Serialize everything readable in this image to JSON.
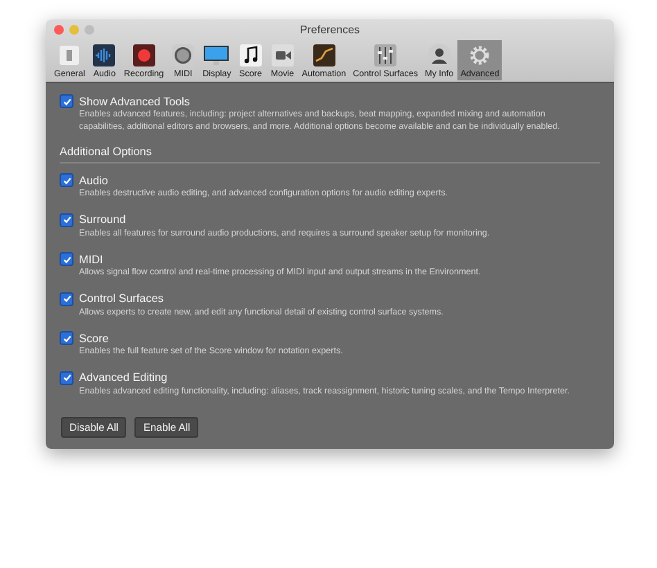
{
  "window": {
    "title": "Preferences"
  },
  "toolbar": [
    {
      "label": "General",
      "selected": false
    },
    {
      "label": "Audio",
      "selected": false
    },
    {
      "label": "Recording",
      "selected": false
    },
    {
      "label": "MIDI",
      "selected": false
    },
    {
      "label": "Display",
      "selected": false
    },
    {
      "label": "Score",
      "selected": false
    },
    {
      "label": "Movie",
      "selected": false
    },
    {
      "label": "Automation",
      "selected": false
    },
    {
      "label": "Control Surfaces",
      "selected": false
    },
    {
      "label": "My Info",
      "selected": false
    },
    {
      "label": "Advanced",
      "selected": true
    }
  ],
  "main_option": {
    "label": "Show Advanced Tools",
    "checked": true,
    "description": "Enables advanced features, including: project alternatives and backups, beat mapping, expanded mixing and automation capabilities, additional editors and browsers, and more. Additional options become available and can be individually enabled."
  },
  "section": {
    "title": "Additional Options",
    "options": [
      {
        "label": "Audio",
        "checked": true,
        "description": "Enables destructive audio editing, and advanced configuration options for audio editing experts."
      },
      {
        "label": "Surround",
        "checked": true,
        "description": "Enables all features for surround audio productions, and requires a surround speaker setup for monitoring."
      },
      {
        "label": "MIDI",
        "checked": true,
        "description": "Allows signal flow control and real-time processing of MIDI input and output streams in the Environment."
      },
      {
        "label": "Control Surfaces",
        "checked": true,
        "description": "Allows experts to create new, and edit any functional detail of existing control surface systems."
      },
      {
        "label": "Score",
        "checked": true,
        "description": "Enables the full feature set of the Score window for notation experts."
      },
      {
        "label": "Advanced Editing",
        "checked": true,
        "description": "Enables advanced editing functionality, including: aliases, track reassignment, historic tuning scales, and the Tempo Interpreter."
      }
    ]
  },
  "buttons": [
    "Disable All",
    "Enable All"
  ]
}
